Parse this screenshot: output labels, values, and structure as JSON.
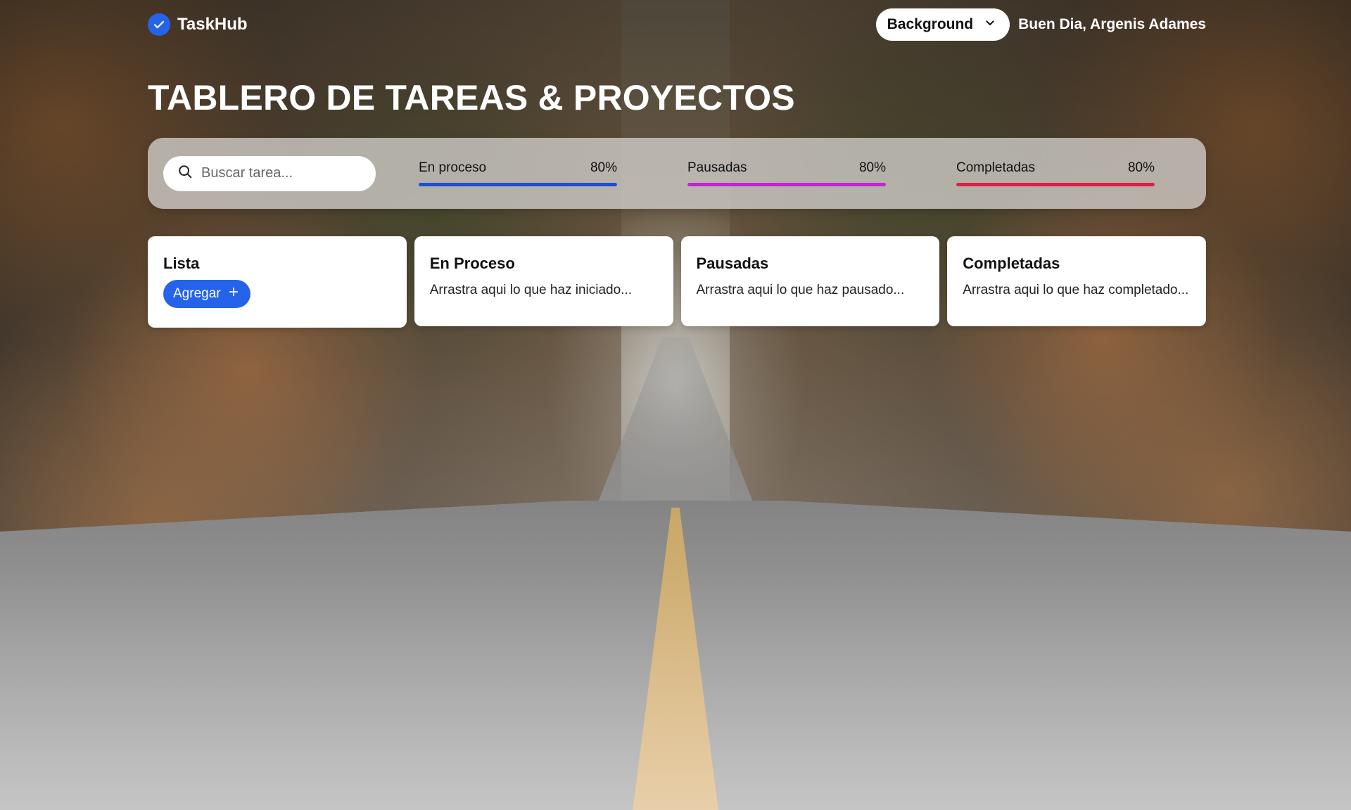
{
  "header": {
    "brand": "TaskHub",
    "background_select": "Background",
    "greeting": "Buen Dia, Argenis Adames"
  },
  "title": "TABLERO DE TAREAS & PROYECTOS",
  "search": {
    "placeholder": "Buscar tarea..."
  },
  "stats": [
    {
      "label": "En proceso",
      "percent_label": "80%",
      "percent": 100,
      "color": "#1d4ed8"
    },
    {
      "label": "Pausadas",
      "percent_label": "80%",
      "percent": 100,
      "color": "#c026d3"
    },
    {
      "label": "Completadas",
      "percent_label": "80%",
      "percent": 100,
      "color": "#e11d48"
    }
  ],
  "columns": [
    {
      "title": "Lista",
      "button": "Agregar"
    },
    {
      "title": "En Proceso",
      "hint": "Arrastra aqui lo que haz iniciado..."
    },
    {
      "title": "Pausadas",
      "hint": "Arrastra aqui lo que haz pausado..."
    },
    {
      "title": "Completadas",
      "hint": "Arrastra aqui lo que haz completado..."
    }
  ],
  "colors": {
    "accent": "#2563eb"
  }
}
